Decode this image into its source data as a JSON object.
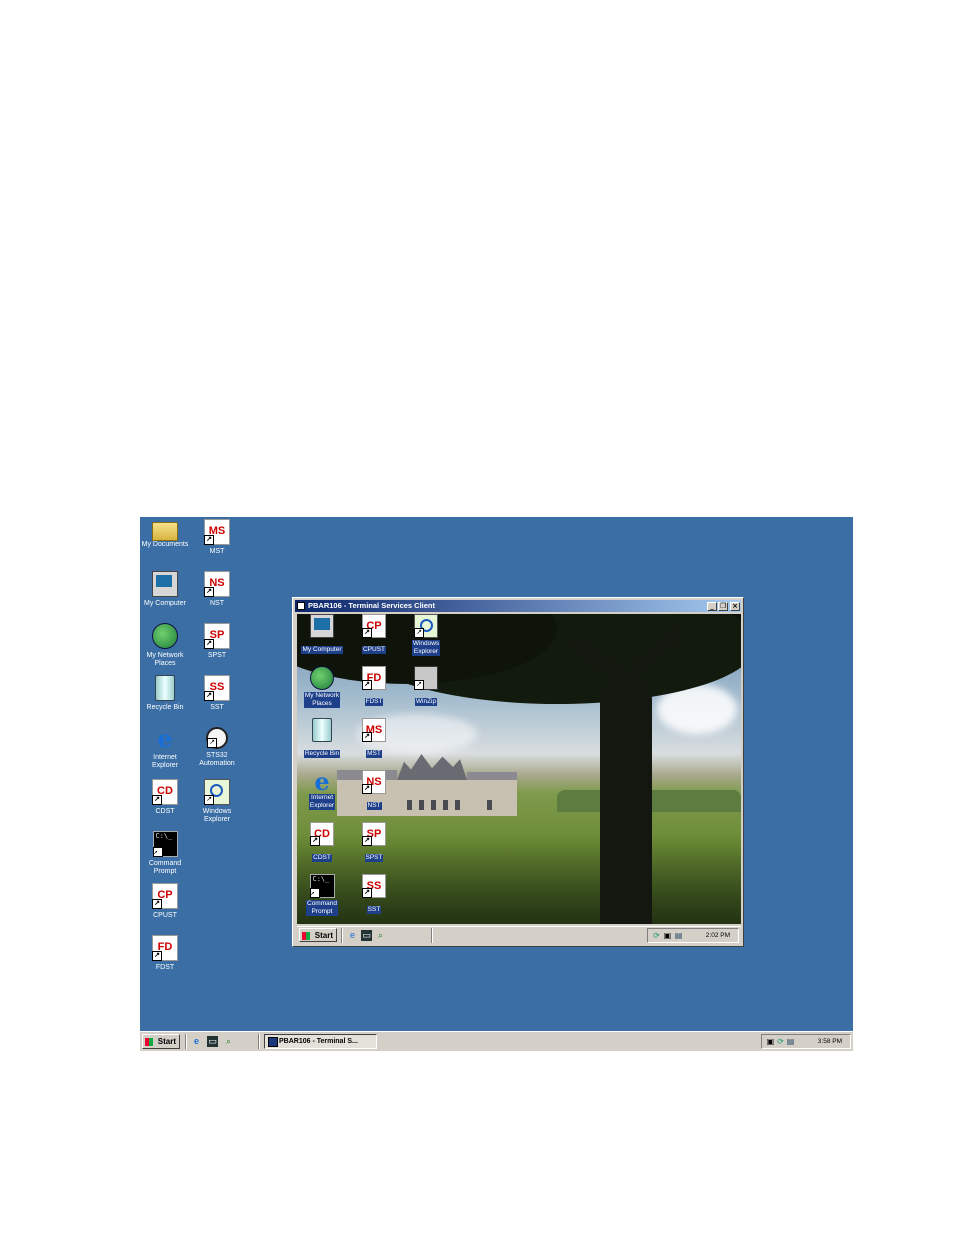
{
  "desktop": {
    "background_color": "#3a6ea5",
    "icons": [
      {
        "label_lines": [
          "My Documents"
        ],
        "icon": "folder-icon"
      },
      {
        "label_lines": [
          "MST"
        ],
        "icon": "mst-icon"
      },
      {
        "label_lines": [
          "My Computer"
        ],
        "icon": "computer-icon"
      },
      {
        "label_lines": [
          "NST"
        ],
        "icon": "nst-icon"
      },
      {
        "label_lines": [
          "My Network",
          "Places"
        ],
        "icon": "network-icon"
      },
      {
        "label_lines": [
          "SPST"
        ],
        "icon": "spst-icon"
      },
      {
        "label_lines": [
          "Recycle Bin"
        ],
        "icon": "recycle-bin-icon"
      },
      {
        "label_lines": [
          "SST"
        ],
        "icon": "sst-icon"
      },
      {
        "label_lines": [
          "Internet",
          "Explorer"
        ],
        "icon": "internet-explorer-icon"
      },
      {
        "label_lines": [
          "STS32",
          "Automation"
        ],
        "icon": "stopwatch-icon"
      },
      {
        "label_lines": [
          "CDST"
        ],
        "icon": "cdst-icon"
      },
      {
        "label_lines": [
          "Windows",
          "Explorer"
        ],
        "icon": "windows-explorer-icon"
      },
      {
        "label_lines": [
          "Command",
          "Prompt"
        ],
        "icon": "command-prompt-icon"
      },
      {
        "label_lines": [
          "CPUST"
        ],
        "icon": "cpust-icon"
      },
      {
        "label_lines": [
          "FDST"
        ],
        "icon": "fdst-icon"
      }
    ]
  },
  "taskbar": {
    "start_label": "Start",
    "quick_launch": [
      "internet-explorer-icon",
      "desktop-icon",
      "explorer-icon"
    ],
    "task_button_label": "PBAR106 - Terminal S...",
    "tray_icons": [
      "network-tray-icon",
      "volume-tray-icon",
      "monitor-tray-icon"
    ],
    "clock": "3:58 PM"
  },
  "ts_window": {
    "title": "PBAR106 - Terminal Services Client",
    "controls": {
      "minimize": "_",
      "restore": "❐",
      "close": "×"
    },
    "remote_desktop": {
      "icons": [
        {
          "label_lines": [
            "My Computer"
          ],
          "icon": "computer-icon"
        },
        {
          "label_lines": [
            "CPUST"
          ],
          "icon": "cpust-icon"
        },
        {
          "label_lines": [
            "Windows",
            "Explorer"
          ],
          "icon": "windows-explorer-icon"
        },
        {
          "label_lines": [
            "My Network",
            "Places"
          ],
          "icon": "network-icon"
        },
        {
          "label_lines": [
            "FDST"
          ],
          "icon": "fdst-icon"
        },
        {
          "label_lines": [
            "WinZip"
          ],
          "icon": "winzip-icon"
        },
        {
          "label_lines": [
            "Recycle Bin"
          ],
          "icon": "recycle-bin-icon"
        },
        {
          "label_lines": [
            "MST"
          ],
          "icon": "mst-icon"
        },
        {
          "label_lines": [
            "Internet",
            "Explorer"
          ],
          "icon": "internet-explorer-icon"
        },
        {
          "label_lines": [
            "NST"
          ],
          "icon": "nst-icon"
        },
        {
          "label_lines": [
            "CDST"
          ],
          "icon": "cdst-icon"
        },
        {
          "label_lines": [
            "SPST"
          ],
          "icon": "spst-icon"
        },
        {
          "label_lines": [
            "Command",
            "Prompt"
          ],
          "icon": "command-prompt-icon"
        },
        {
          "label_lines": [
            "SST"
          ],
          "icon": "sst-icon"
        }
      ]
    },
    "taskbar": {
      "start_label": "Start",
      "clock": "2:02 PM"
    }
  }
}
